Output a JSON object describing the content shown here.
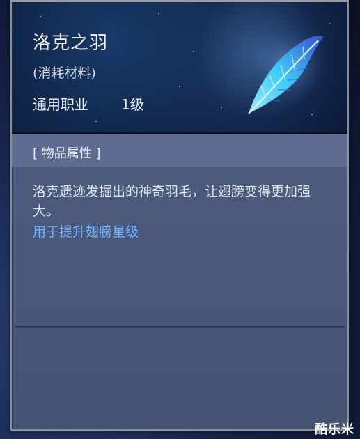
{
  "item": {
    "name": "洛克之羽",
    "type": "(消耗材料)",
    "class": "通用职业",
    "level": "1级",
    "icon": "feather-icon"
  },
  "section": {
    "title": "[ 物品属性 ]"
  },
  "description": "洛克遗迹发掘出的神奇羽毛，让翅膀变得更加强大。",
  "effect": "用于提升翅膀星级",
  "watermark": "酷乐米",
  "colors": {
    "panel": "#4f5e82",
    "header": "#0f2447",
    "effect_text": "#6fb6ff",
    "feather": "#3fd4ff"
  }
}
